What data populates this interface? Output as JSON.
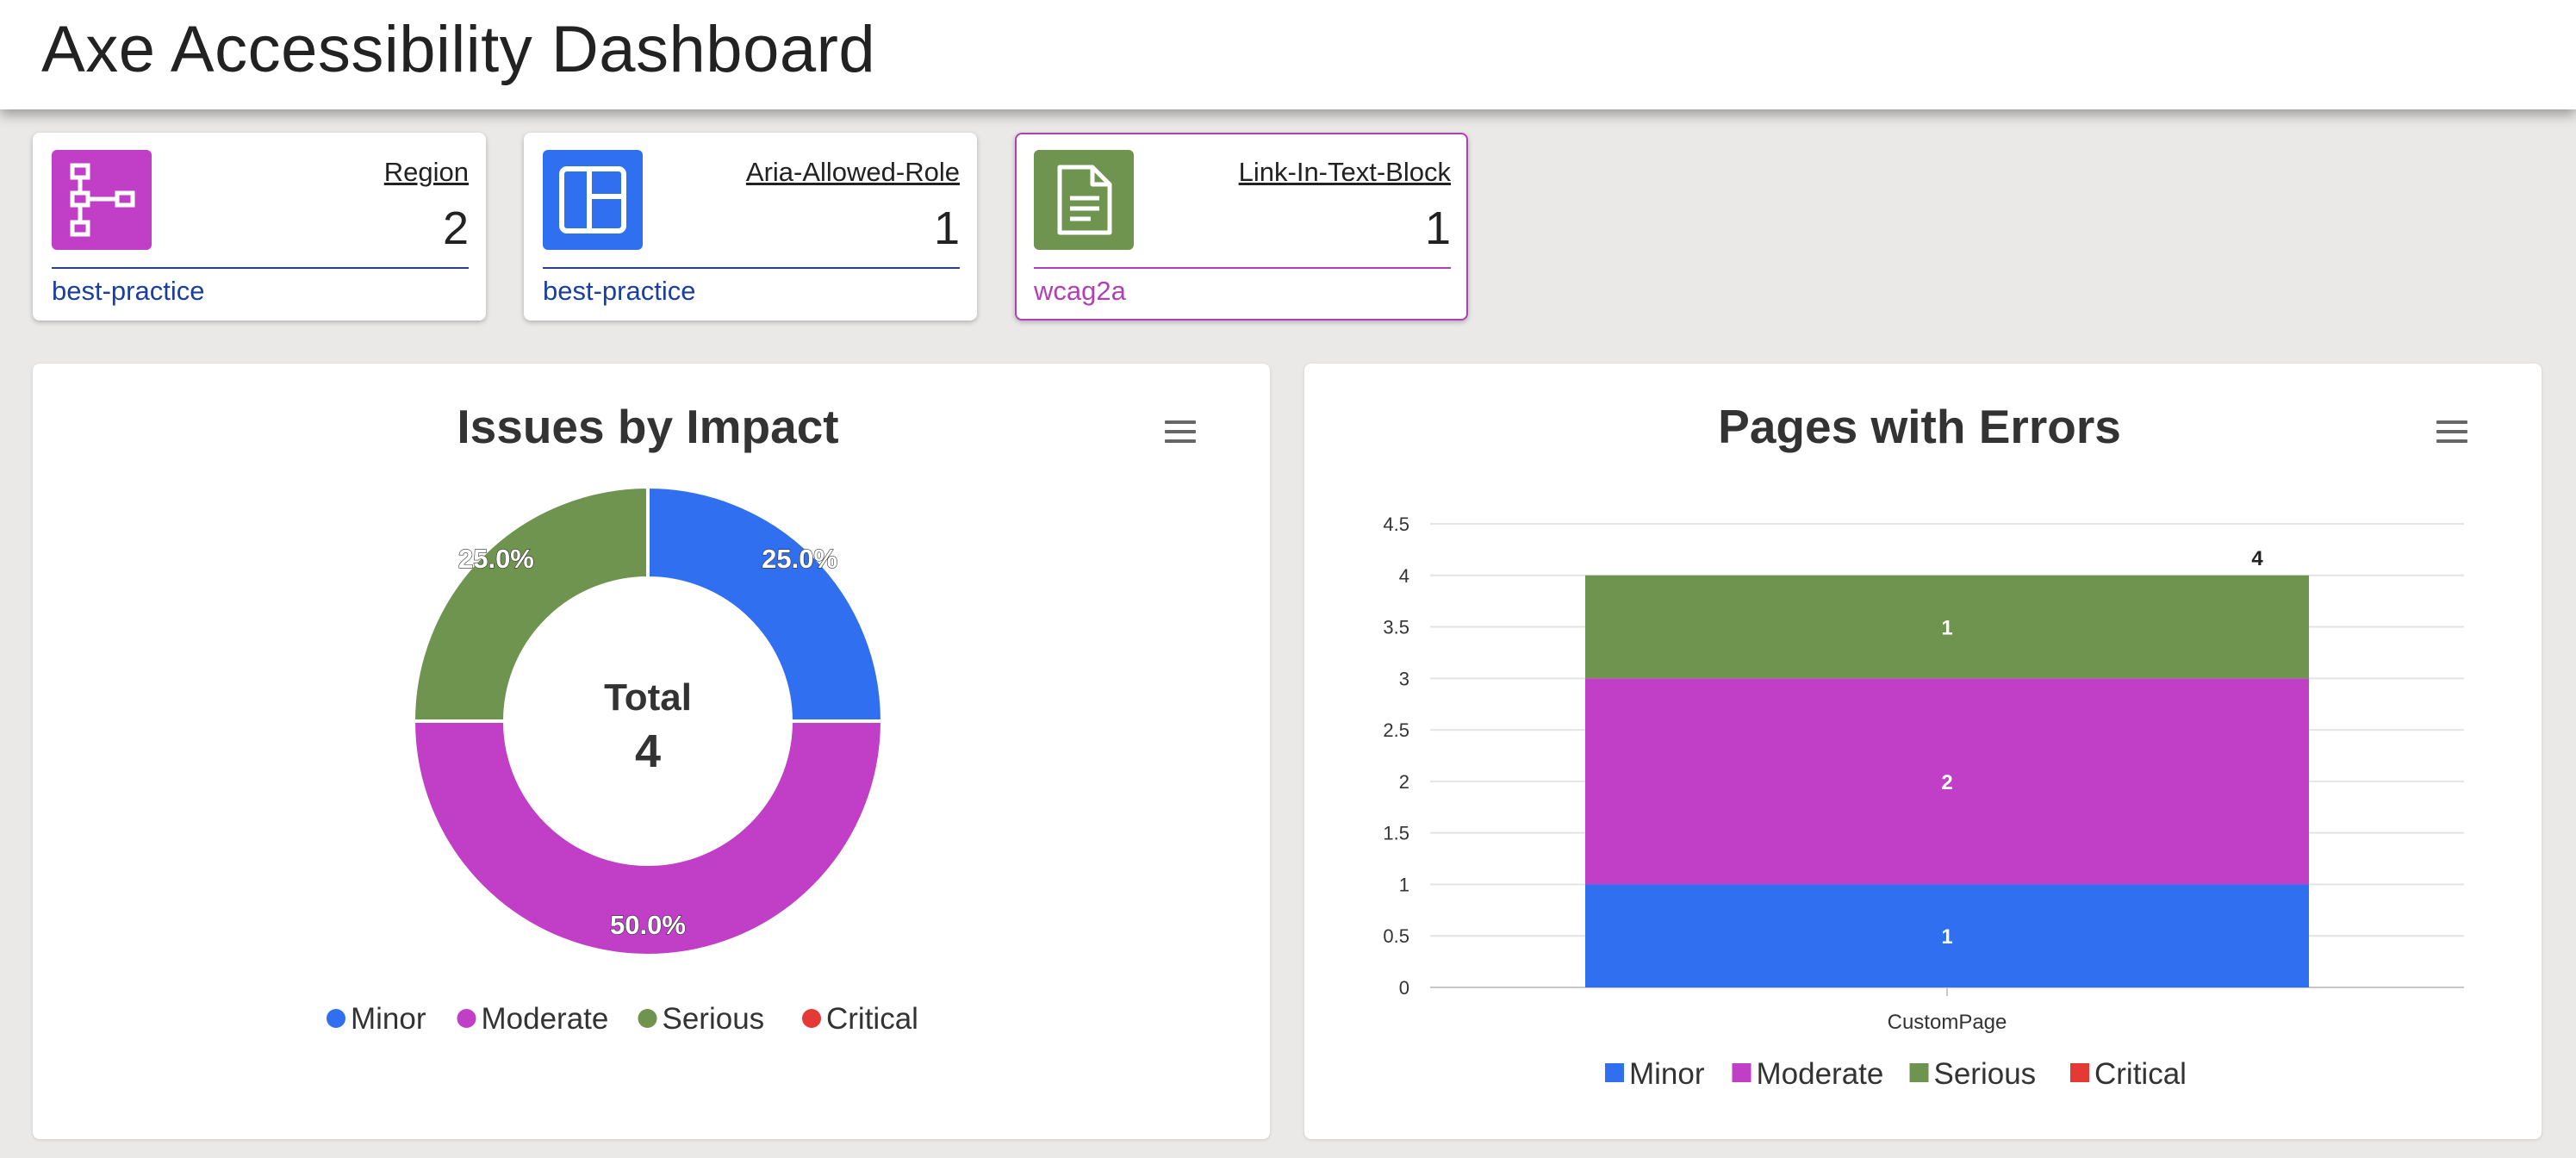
{
  "header": {
    "title": "Axe Accessibility Dashboard"
  },
  "tiles": [
    {
      "rule": "Region",
      "count": "2",
      "tag": "best-practice",
      "icon": "sitemap-icon",
      "color": "#c03fc6",
      "tag_color": "#1a3fa0",
      "rule_line": "#2a3f8a"
    },
    {
      "rule": "Aria-Allowed-Role",
      "count": "1",
      "tag": "best-practice",
      "icon": "layout-icon",
      "color": "#2f6ff0",
      "tag_color": "#1a3fa0",
      "rule_line": "#2a3f8a"
    },
    {
      "rule": "Link-In-Text-Block",
      "count": "1",
      "tag": "wcag2a",
      "icon": "document-icon",
      "color": "#6e9450",
      "tag_color": "#b040b8",
      "rule_line": "#b040b8"
    }
  ],
  "colors": {
    "minor": "#2f6ff0",
    "moderate": "#c03fc6",
    "serious": "#6e9450",
    "critical": "#e53935"
  },
  "legend": [
    "Minor",
    "Moderate",
    "Serious",
    "Critical"
  ],
  "impact_chart": {
    "title": "Issues by Impact",
    "center_label": "Total",
    "center_value": "4"
  },
  "pages_chart": {
    "title": "Pages with Errors"
  },
  "chart_data": [
    {
      "type": "pie",
      "title": "Issues by Impact",
      "labels": [
        "Minor",
        "Moderate",
        "Serious",
        "Critical"
      ],
      "values": [
        1,
        2,
        1,
        0
      ],
      "slice_labels": [
        "25.0%",
        "50.0%",
        "25.0%",
        ""
      ],
      "donut": true,
      "legend": "bottom"
    },
    {
      "type": "bar",
      "stacked": true,
      "title": "Pages with Errors",
      "categories": [
        "CustomPage"
      ],
      "series": [
        {
          "name": "Minor",
          "values": [
            1
          ]
        },
        {
          "name": "Moderate",
          "values": [
            2
          ]
        },
        {
          "name": "Serious",
          "values": [
            1
          ]
        },
        {
          "name": "Critical",
          "values": [
            0
          ]
        }
      ],
      "total_labels": [
        "4"
      ],
      "ylim": [
        0,
        4.5
      ],
      "yticks": [
        "0",
        "0.5",
        "1",
        "1.5",
        "2",
        "2.5",
        "3",
        "3.5",
        "4",
        "4.5"
      ],
      "grid": true,
      "legend": "bottom"
    }
  ]
}
